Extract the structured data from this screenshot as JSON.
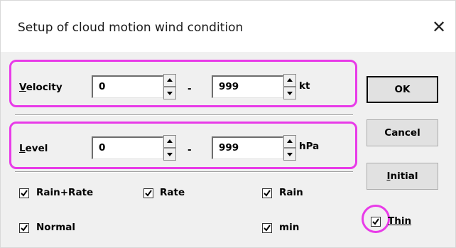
{
  "window": {
    "title": "Setup of cloud motion wind condition",
    "close_glyph": "✕"
  },
  "velocity": {
    "label_first": "V",
    "label_rest": "elocity",
    "min": "0",
    "max": "999",
    "unit": "kt",
    "dash": "-"
  },
  "level": {
    "label_first": "L",
    "label_rest": "evel",
    "min": "0",
    "max": "999",
    "unit": "hPa",
    "dash": "-"
  },
  "buttons": {
    "ok": "OK",
    "cancel": "Cancel",
    "initial_first": "I",
    "initial_rest": "nitial"
  },
  "checkboxes": {
    "rain_rate": {
      "label": "Rain+Rate",
      "checked": true
    },
    "rate": {
      "label": "Rate",
      "checked": true
    },
    "rain": {
      "label": "Rain",
      "checked": true
    },
    "normal": {
      "label": "Normal",
      "checked": true
    },
    "min": {
      "label": "min",
      "checked": true
    },
    "thin": {
      "label": "Thin",
      "checked": true
    }
  },
  "colors": {
    "highlight": "#e83be8",
    "dialog_bg": "#f0f0f0"
  }
}
